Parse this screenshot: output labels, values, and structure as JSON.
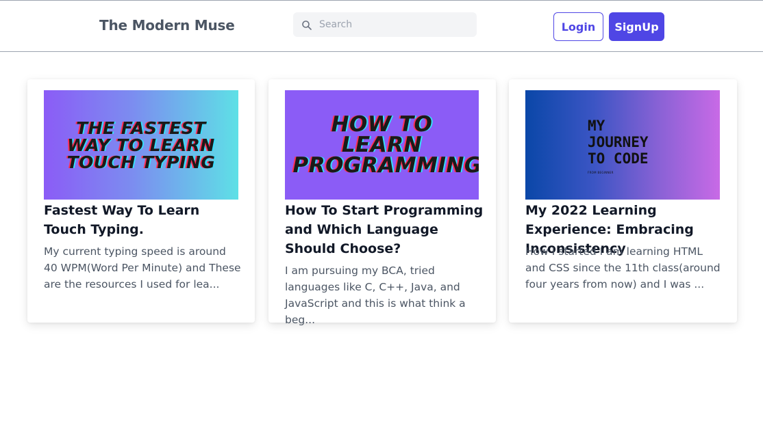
{
  "header": {
    "brand": "The Modern Muse",
    "search_placeholder": "Search",
    "login_label": "Login",
    "signup_label": "SignUp"
  },
  "posts": [
    {
      "thumbnail_text": "THE FASTEST WAY TO LEARN TOUCH TYPING",
      "title": "Fastest Way To Learn Touch Typing.",
      "excerpt": "My current typing speed is around 40 WPM(Word Per Minute) and These are the resources I used for lea..."
    },
    {
      "thumbnail_text": "HOW TO LEARN PROGRAMMING",
      "title": "How To Start Programming and Which Language Should Choose?",
      "excerpt": "I am pursuing my BCA, tried languages like C, C++, Java, and JavaScript and this is what think a beg..."
    },
    {
      "thumbnail_text": "MY JOURNEY TO CODE",
      "thumbnail_subtext": "FROM BEGINNER",
      "title": "My 2022 Learning Experience: Embracing Inconsistency",
      "excerpt": "How I started I am learning HTML and CSS since the 11th class(around four years from now) and I was ..."
    }
  ],
  "footer_fragment": "",
  "colors": {
    "primary": "#4f46e5",
    "brand_text": "#4b5563",
    "search_bg": "#f3f4f6"
  },
  "icons": {
    "search": "search-icon"
  }
}
